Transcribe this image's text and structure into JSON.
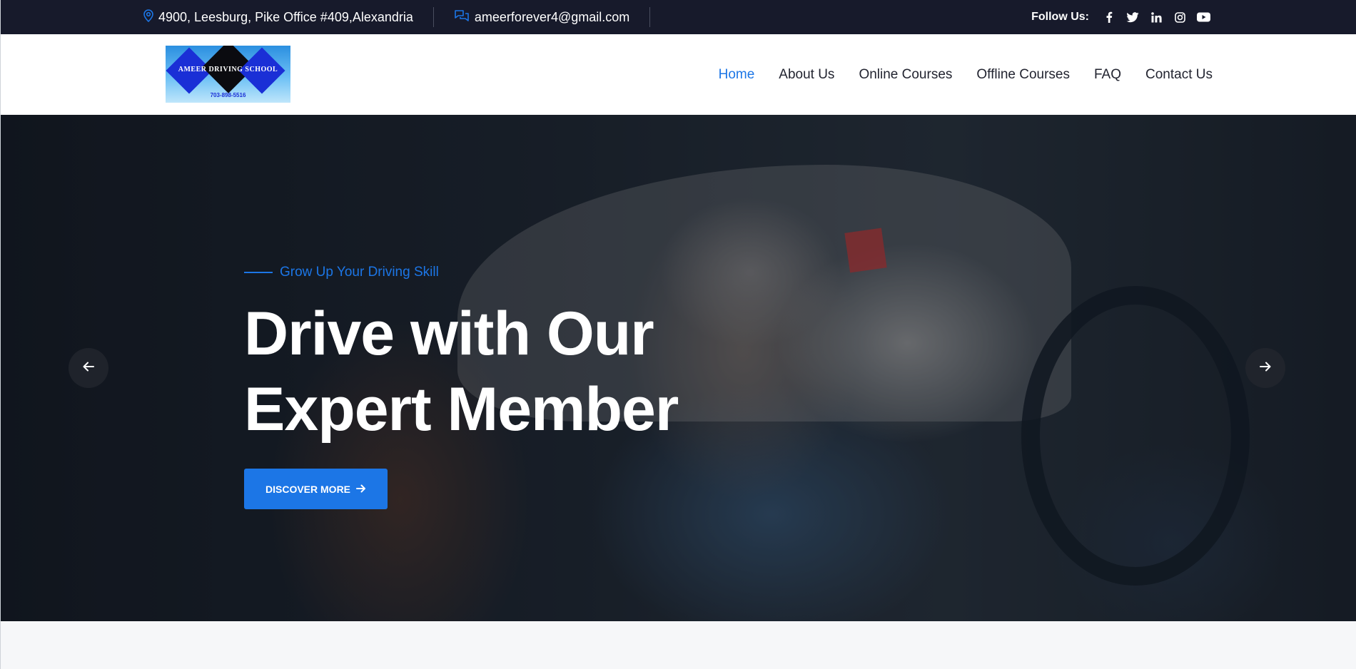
{
  "topbar": {
    "address": "4900, Leesburg, Pike Office #409,Alexandria",
    "email": "ameerforever4@gmail.com",
    "follow_label": "Follow Us:",
    "social_icons": [
      "facebook-icon",
      "twitter-icon",
      "linkedin-icon",
      "instagram-icon",
      "youtube-icon"
    ]
  },
  "header": {
    "logo_text": "AMEER DRIVING SCHOOL",
    "logo_phone": "703-898-5516",
    "nav": [
      {
        "label": "Home",
        "active": true
      },
      {
        "label": "About Us",
        "active": false
      },
      {
        "label": "Online Courses",
        "active": false
      },
      {
        "label": "Offline Courses",
        "active": false
      },
      {
        "label": "FAQ",
        "active": false
      },
      {
        "label": "Contact Us",
        "active": false
      }
    ]
  },
  "hero": {
    "subtitle": "Grow Up Your Driving Skill",
    "headline_line1": "Drive with Our",
    "headline_line2": "Expert Member",
    "cta_label": "DISCOVER MORE"
  },
  "colors": {
    "accent": "#1c76e6",
    "topbar_bg": "#171a2b",
    "nav_text": "#222430"
  }
}
